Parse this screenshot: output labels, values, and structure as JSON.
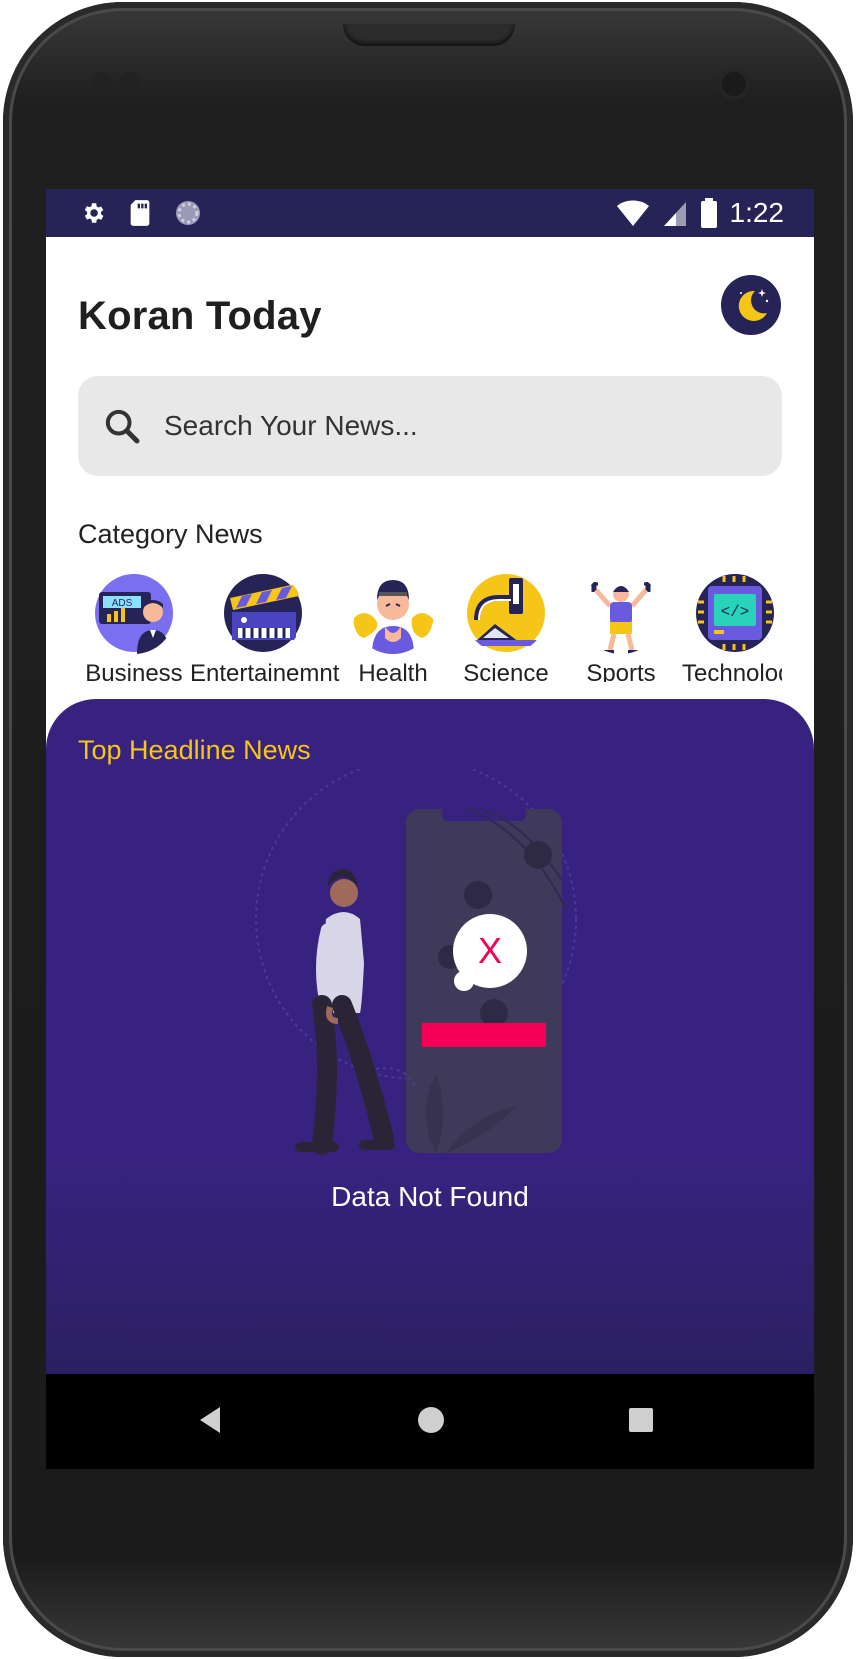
{
  "status_bar": {
    "time": "1:22",
    "left_icons": [
      "gear-icon",
      "sd-card-icon",
      "loading-icon"
    ],
    "right_icons": [
      "wifi-icon",
      "signal-icon",
      "battery-icon"
    ]
  },
  "header": {
    "title": "Koran Today",
    "theme_toggle_icon": "moon-icon"
  },
  "search": {
    "placeholder": "Search Your News..."
  },
  "categories": {
    "title": "Category News",
    "items": [
      {
        "label": "Business",
        "icon": "business-icon"
      },
      {
        "label": "Entertainemnt",
        "icon": "entertainment-icon"
      },
      {
        "label": "Health",
        "icon": "health-icon"
      },
      {
        "label": "Science",
        "icon": "science-icon"
      },
      {
        "label": "Sports",
        "icon": "sports-icon"
      },
      {
        "label": "Technology",
        "icon": "technology-icon"
      }
    ]
  },
  "headlines": {
    "title": "Top Headline News",
    "empty_message": "Data Not Found"
  },
  "colors": {
    "primary": "#262456",
    "panel": "#37237f",
    "accent": "#f5c518",
    "error": "#f50057"
  },
  "nav_bar": {
    "buttons": [
      "back-icon",
      "home-icon",
      "recents-icon"
    ]
  }
}
